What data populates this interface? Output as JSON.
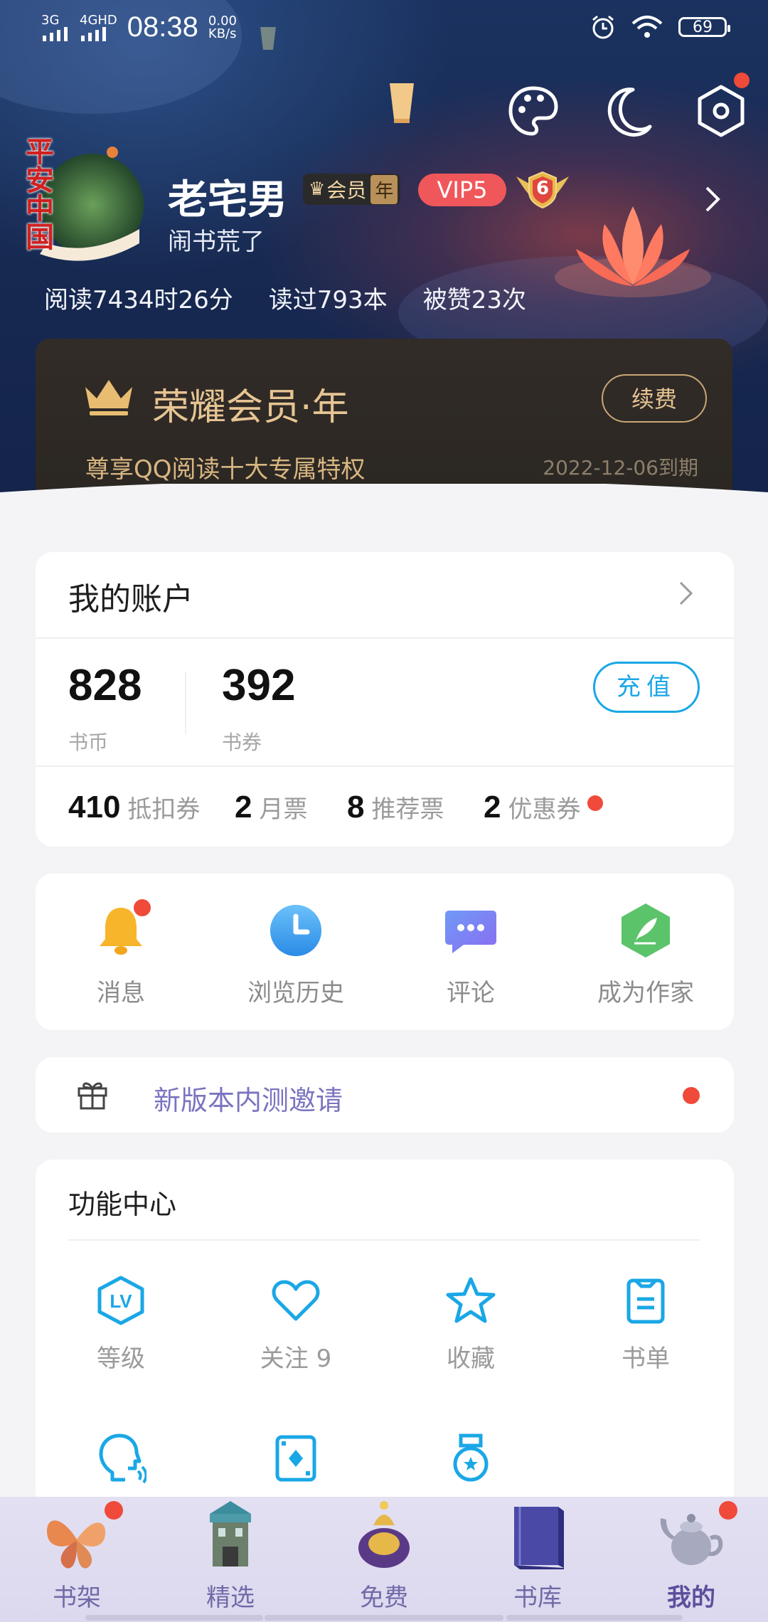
{
  "statusbar": {
    "net1": "3G",
    "net2": "4GHD",
    "time": "08:38",
    "speed_val": "0.00",
    "speed_unit": "KB/s",
    "battery": "69"
  },
  "profile": {
    "name": "老宅男",
    "badge_member": "会员",
    "badge_year": "年",
    "vip": "VIP5",
    "level": "6",
    "subtitle": "闹书荒了",
    "avatar_text": "平安中国",
    "stats": [
      "阅读7434时26分",
      "读过793本",
      "被赞23次"
    ]
  },
  "vip_card": {
    "title": "荣耀会员·年",
    "subtitle": "尊享QQ阅读十大专属特权",
    "expire": "2022-12-06到期",
    "renew": "续费"
  },
  "account": {
    "title": "我的账户",
    "coins": "828",
    "coins_label": "书币",
    "vouchers": "392",
    "vouchers_label": "书券",
    "charge": "充值",
    "tickets": [
      {
        "num": "410",
        "label": "抵扣券"
      },
      {
        "num": "2",
        "label": "月票"
      },
      {
        "num": "8",
        "label": "推荐票"
      },
      {
        "num": "2",
        "label": "优惠券"
      }
    ]
  },
  "quick": [
    {
      "label": "消息",
      "icon": "bell-icon"
    },
    {
      "label": "浏览历史",
      "icon": "clock-icon"
    },
    {
      "label": "评论",
      "icon": "comment-icon"
    },
    {
      "label": "成为作家",
      "icon": "quill-icon"
    }
  ],
  "invite": {
    "text": "新版本内测邀请",
    "icon": "gift-icon"
  },
  "function_center": {
    "title": "功能中心",
    "items": [
      {
        "label": "等级",
        "icon": "level-icon"
      },
      {
        "label": "关注 9",
        "icon": "heart-icon"
      },
      {
        "label": "收藏",
        "icon": "star-icon"
      },
      {
        "label": "书单",
        "icon": "booklist-icon"
      }
    ],
    "row2_icons": [
      "voice-icon",
      "card-icon",
      "medal-icon"
    ]
  },
  "bottom_nav": [
    {
      "label": "书架",
      "icon": "butterfly-icon"
    },
    {
      "label": "精选",
      "icon": "tower-icon"
    },
    {
      "label": "免费",
      "icon": "bag-icon"
    },
    {
      "label": "书库",
      "icon": "book-icon"
    },
    {
      "label": "我的",
      "icon": "teapot-icon"
    }
  ],
  "colors": {
    "accent": "#1aa7e6",
    "gold": "#e6c493",
    "red_dot": "#f04a3a",
    "vip_red": "#f0575a"
  }
}
